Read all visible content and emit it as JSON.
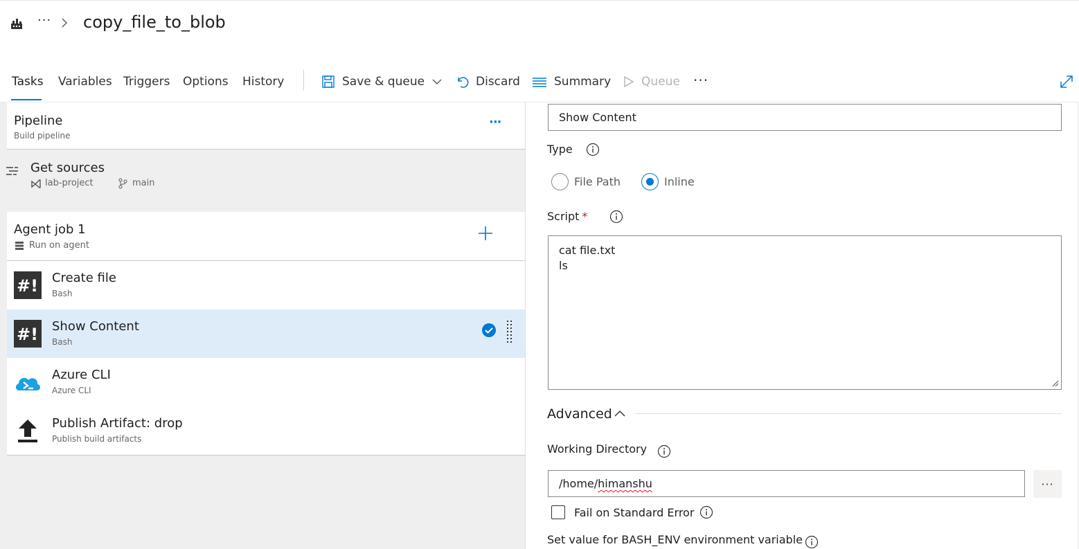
{
  "header": {
    "breadcrumb_more": "···",
    "title": "copy_file_to_blob"
  },
  "tabs": [
    {
      "label": "Tasks",
      "active": true
    },
    {
      "label": "Variables"
    },
    {
      "label": "Triggers"
    },
    {
      "label": "Options"
    },
    {
      "label": "History"
    }
  ],
  "toolbar": {
    "save_queue": "Save & queue",
    "discard": "Discard",
    "summary": "Summary",
    "queue": "Queue",
    "more": "···"
  },
  "pipeline": {
    "name": "Pipeline",
    "subtitle": "Build pipeline",
    "more": "···"
  },
  "get_sources": {
    "title": "Get sources",
    "repo": "lab-project",
    "branch": "main"
  },
  "agent_job": {
    "name": "Agent job 1",
    "subtitle": "Run on agent"
  },
  "tasks": [
    {
      "name": "Create file",
      "type": "Bash",
      "icon": "bash-icon"
    },
    {
      "name": "Show Content",
      "type": "Bash",
      "icon": "bash-icon",
      "selected": true
    },
    {
      "name": "Azure CLI",
      "type": "Azure CLI",
      "icon": "azure-cli-icon"
    },
    {
      "name": "Publish Artifact: drop",
      "type": "Publish build artifacts",
      "icon": "upload-icon"
    }
  ],
  "details": {
    "display_name_value": "Show Content",
    "type_label": "Type",
    "type_options": [
      "File Path",
      "Inline"
    ],
    "type_selected": "Inline",
    "script_label": "Script",
    "script_required": "*",
    "script_value": "cat file.txt\nls",
    "advanced_label": "Advanced",
    "working_dir_label": "Working Directory",
    "working_dir_prefix": "/home/",
    "working_dir_user": "himanshu",
    "browse_more": "···",
    "fail_on_stderr_label": "Fail on Standard Error",
    "fail_on_stderr_checked": false,
    "bash_env_label": "Set value for BASH_ENV environment variable"
  },
  "colors": {
    "accent": "#0078d4",
    "selected_row": "#deecf9",
    "required": "#a4262c"
  }
}
